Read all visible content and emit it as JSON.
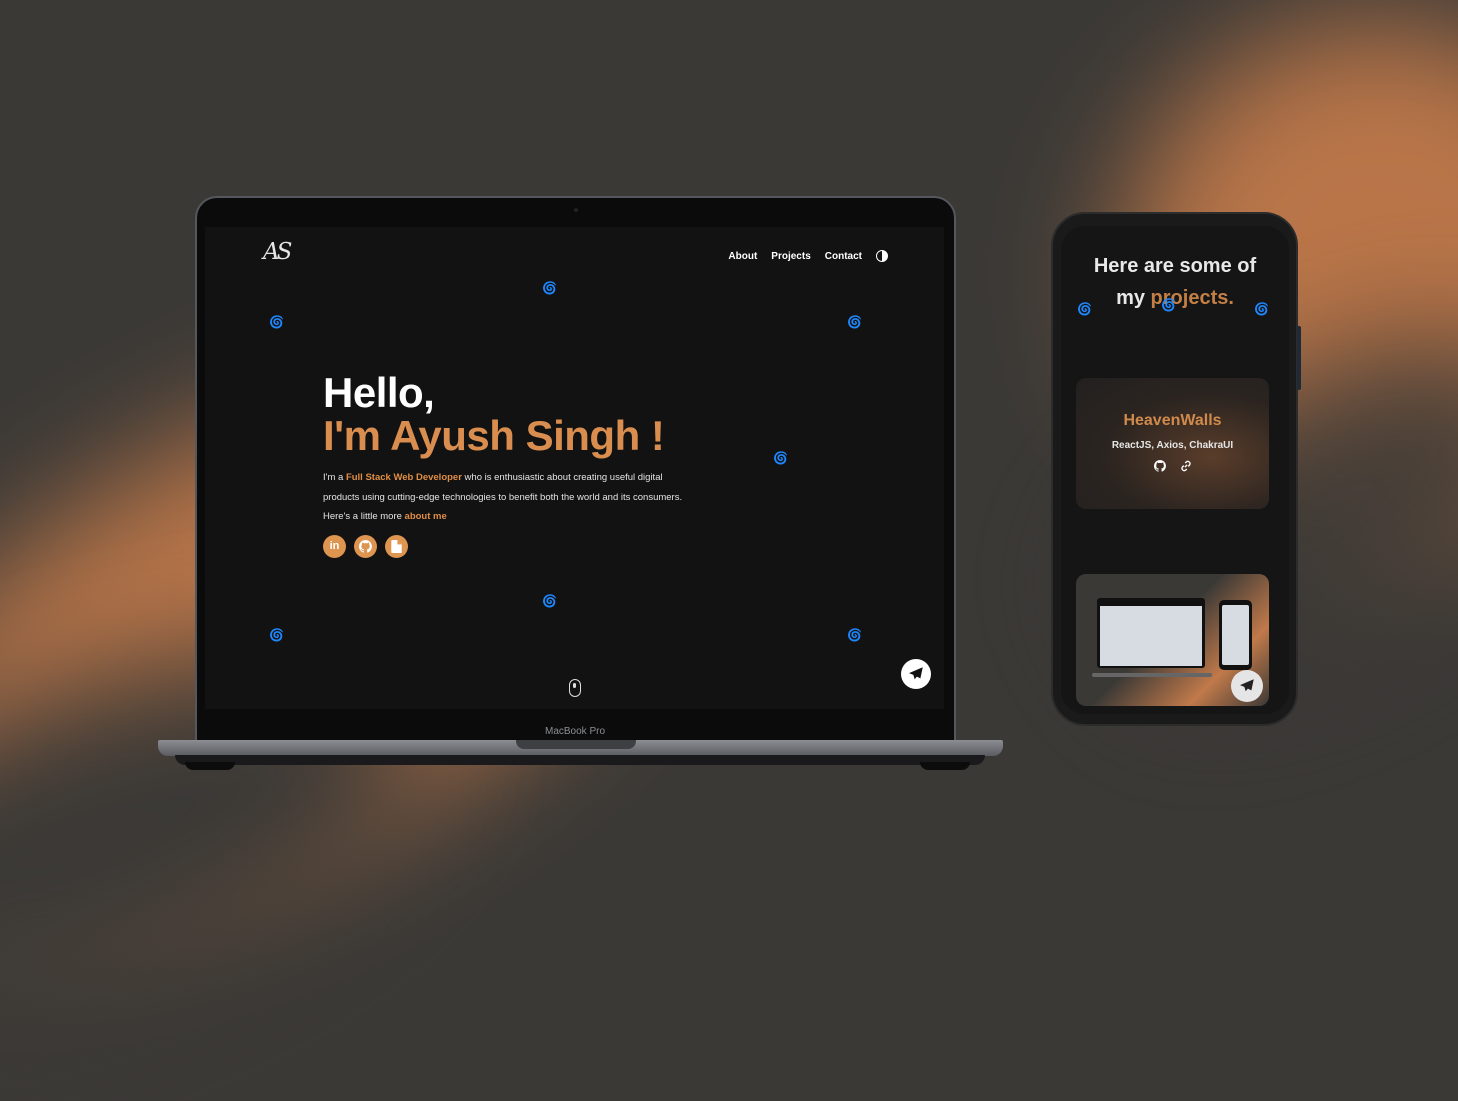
{
  "laptop": {
    "brand_label": "MacBook Pro",
    "site": {
      "logo": "AS",
      "nav": {
        "about": "About",
        "projects": "Projects",
        "contact": "Contact"
      },
      "hero": {
        "greeting": "Hello,",
        "name": "I'm Ayush Singh !",
        "desc_prefix": "I'm a ",
        "desc_role": "Full Stack Web Developer",
        "desc_middle": " who is enthusiastic about creating useful digital products using cutting-edge technologies to benefit both the world and its consumers. Here's a little more ",
        "desc_link": "about me"
      },
      "socials": [
        "linkedin-icon",
        "github-icon",
        "resume-icon"
      ],
      "accent_color": "#dd9550"
    }
  },
  "phone": {
    "heading_line1": "Here are some of",
    "heading_my": "my ",
    "heading_highlight": "projects.",
    "project": {
      "title": "HeavenWalls",
      "stack": "ReactJS, Axios, ChakraUI"
    }
  }
}
